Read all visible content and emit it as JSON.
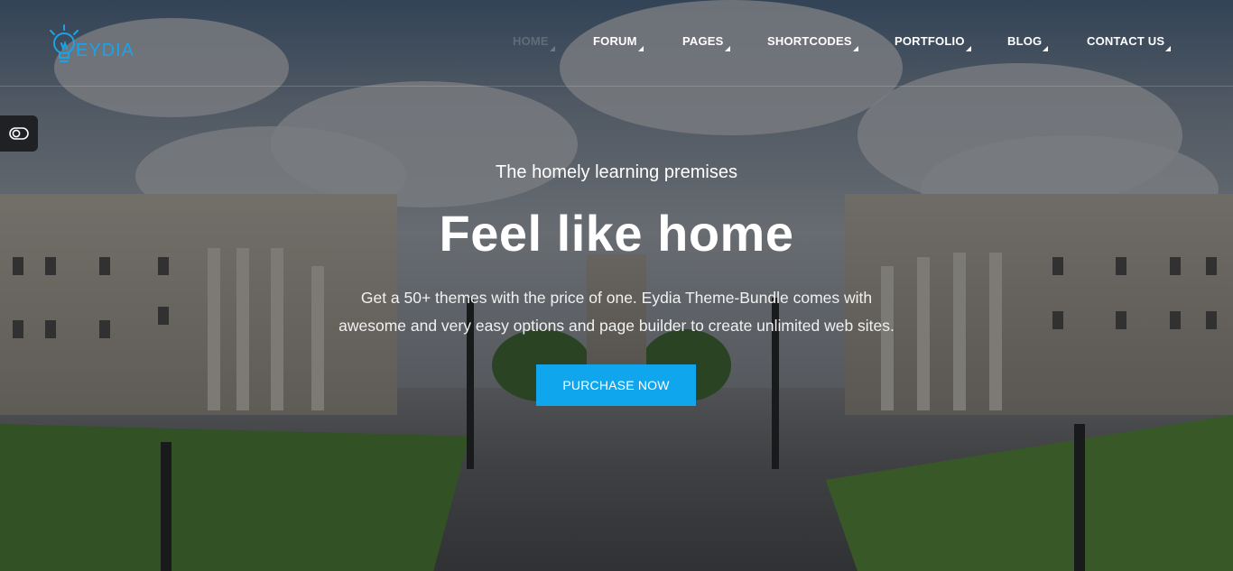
{
  "brand": {
    "logo_text": "EYDIA",
    "accent_color": "#1aa3e8"
  },
  "nav": {
    "items": [
      {
        "label": "HOME",
        "active": true
      },
      {
        "label": "FORUM"
      },
      {
        "label": "PAGES"
      },
      {
        "label": "SHORTCODES"
      },
      {
        "label": "PORTFOLIO"
      },
      {
        "label": "BLOG"
      },
      {
        "label": "CONTACT US"
      }
    ]
  },
  "side_toggle": {
    "icon": "toggle-icon"
  },
  "hero": {
    "subtitle": "The homely learning premises",
    "title": "Feel like home",
    "description_line1": "Get a 50+ themes with the price of one. Eydia Theme-Bundle comes with",
    "description_line2": "awesome and very easy options and page builder to create unlimited web sites.",
    "cta_label": "PURCHASE NOW",
    "cta_color": "#10a6ee"
  }
}
